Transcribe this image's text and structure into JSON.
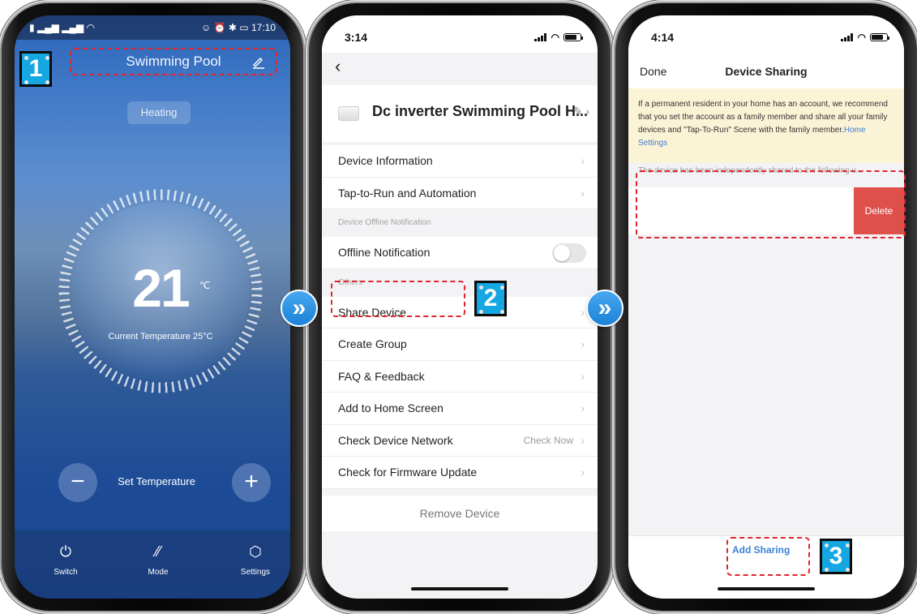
{
  "panel1": {
    "status_right": "☺ ⏰ ✱ ▭ 17:10",
    "title": "Swimming Pool",
    "mode_pill": "Heating",
    "set_temperature": "21",
    "unit": "℃",
    "current_temp": "Current Temperature 25°C",
    "set_label": "Set Temperature",
    "tabs": [
      {
        "label": "Switch",
        "icon": "power-icon"
      },
      {
        "label": "Mode",
        "icon": "mode-icon"
      },
      {
        "label": "Settings",
        "icon": "cube-icon"
      }
    ]
  },
  "panel2": {
    "time": "3:14",
    "device_name": "Dc inverter Swimming Pool H...",
    "items": {
      "device_information": "Device Information",
      "tap_to_run": "Tap-to-Run and Automation",
      "section_offline": "Device Offline Notification",
      "offline_notification": "Offline Notification",
      "section_others": "Others",
      "share_device": "Share Device",
      "create_group": "Create Group",
      "faq": "FAQ & Feedback",
      "add_home": "Add to Home Screen",
      "check_network": "Check Device Network",
      "check_network_value": "Check Now",
      "firmware": "Check for Firmware Update"
    },
    "remove": "Remove Device",
    "offline_toggle_on": false
  },
  "panel3": {
    "time": "4:14",
    "done": "Done",
    "title": "Device Sharing",
    "notice_text": "If a permanent resident in your home has an account, we recommend that you set the account as a family member and share all your family devices and \"Tap-To-Run\" Scene with the family member.",
    "notice_link": "Home Settings",
    "shared_caption": "The device has been independently shared to the following u...",
    "delete": "Delete",
    "add_sharing": "Add Sharing"
  },
  "steps": [
    "1",
    "2",
    "3"
  ],
  "arrow_glyph": "»",
  "colors": {
    "highlight": "#e0252e",
    "step_marker": "#14a7e1",
    "link": "#3b7fd6",
    "delete": "#e0504a"
  }
}
